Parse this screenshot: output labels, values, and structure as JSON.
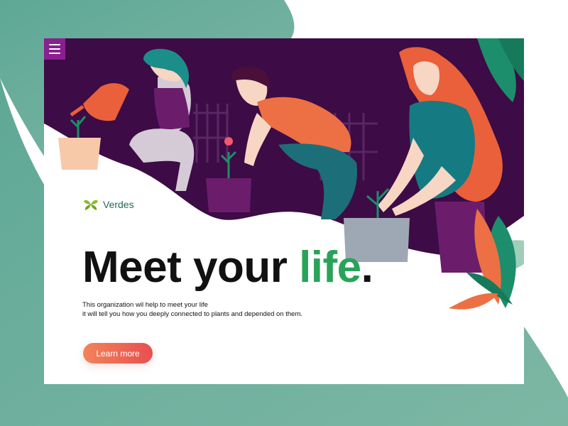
{
  "header": {
    "menu_icon": "hamburger-menu-icon"
  },
  "brand": {
    "name": "Verdes",
    "logo_icon": "leaf-cluster-icon"
  },
  "hero": {
    "headline_prefix": "Meet your ",
    "headline_accent": "life",
    "headline_suffix": ".",
    "tagline_line1": "This organization wil help to meet your life",
    "tagline_line2": "it will tell you how you deeply connected to plants and depended on them.",
    "cta_label": "Learn more"
  },
  "colors": {
    "background_teal": "#6fae9b",
    "hero_purple": "#3d0b45",
    "accent_green": "#2aa35a",
    "cta_orange": "#f2845b",
    "cta_red": "#e84f4f",
    "menu_magenta": "#8a1f8f"
  }
}
